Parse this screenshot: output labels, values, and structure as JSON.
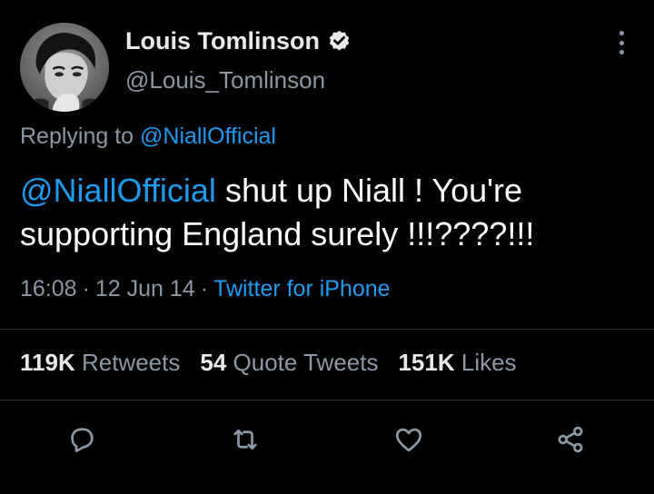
{
  "author": {
    "display_name": "Louis Tomlinson",
    "handle": "@Louis_Tomlinson",
    "verified": true,
    "avatar_icon": "profile-photo"
  },
  "reply": {
    "prefix": "Replying to",
    "mention": "@NiallOfficial"
  },
  "tweet": {
    "mention": "@NiallOfficial",
    "text": " shut up Niall ! You're supporting England surely !!!????!!!"
  },
  "meta": {
    "time": "16:08",
    "date": "12 Jun 14",
    "source": "Twitter for iPhone",
    "separator": "·"
  },
  "stats": {
    "retweets_count": "119K",
    "retweets_label": "Retweets",
    "quotes_count": "54",
    "quotes_label": "Quote Tweets",
    "likes_count": "151K",
    "likes_label": "Likes"
  },
  "actions": [
    "reply-icon",
    "retweet-icon",
    "like-icon",
    "share-icon"
  ],
  "colors": {
    "background": "#000000",
    "accent": "#1d9bf0",
    "secondary_text": "#8b98a5",
    "primary_text": "#e7e9ea"
  }
}
